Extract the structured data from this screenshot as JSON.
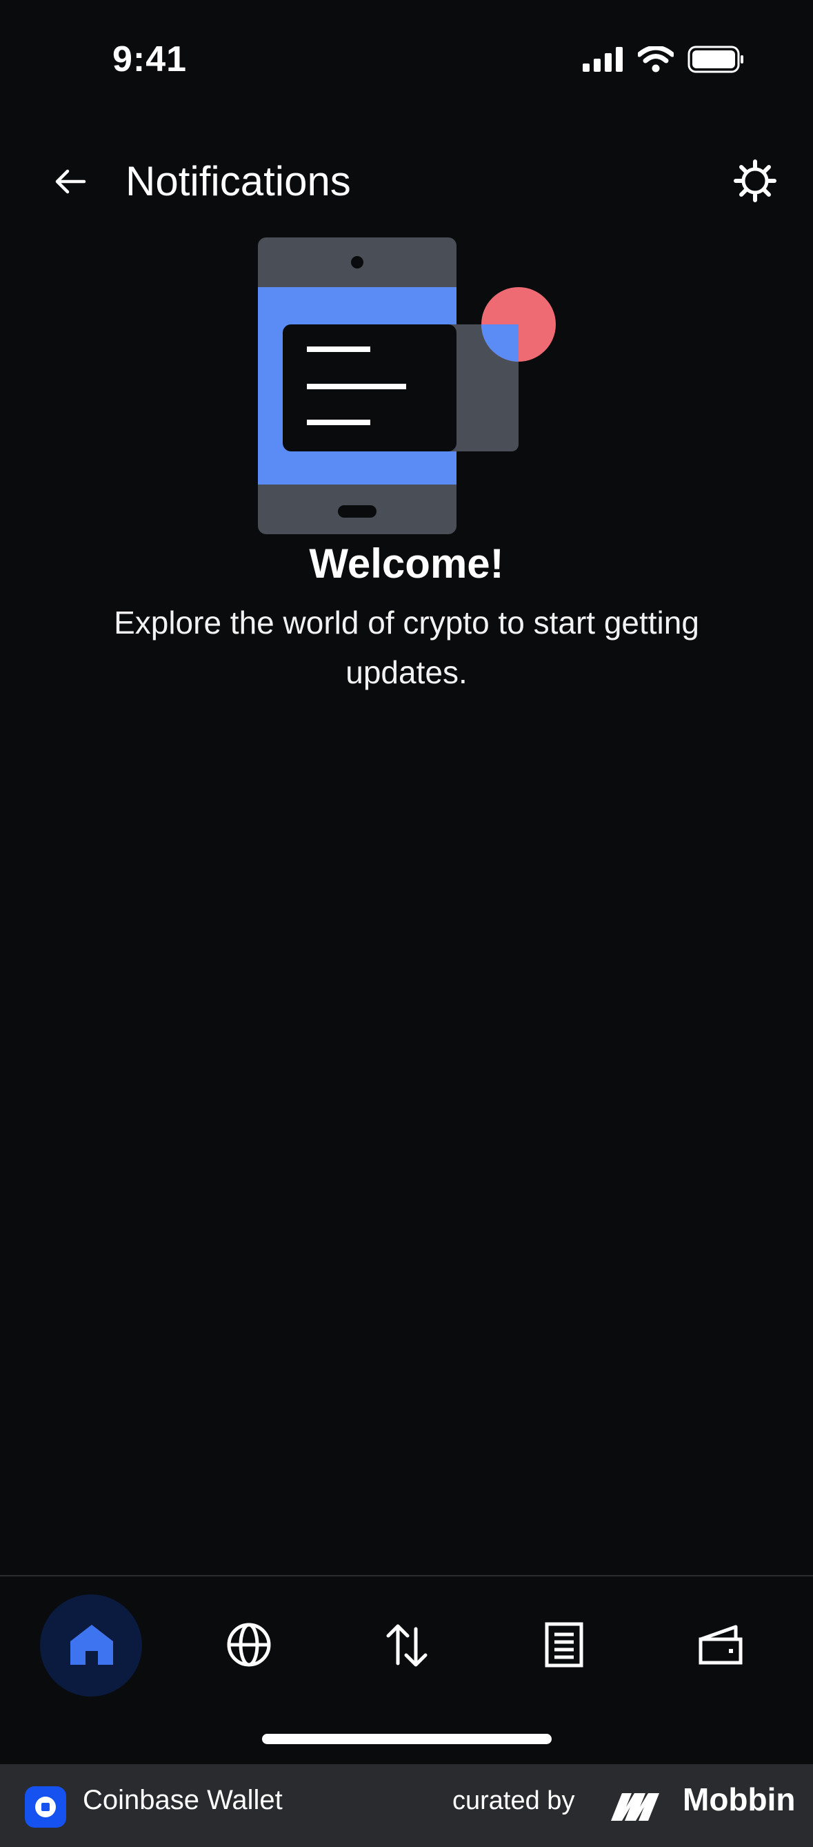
{
  "status_bar": {
    "time": "9:41"
  },
  "header": {
    "title": "Notifications"
  },
  "empty_state": {
    "title": "Welcome!",
    "message": "Explore the world of crypto to start getting updates."
  },
  "tab_bar": {
    "tabs": [
      {
        "icon": "home-icon",
        "active": true
      },
      {
        "icon": "globe-icon",
        "active": false
      },
      {
        "icon": "swap-arrows-icon",
        "active": false
      },
      {
        "icon": "document-icon",
        "active": false
      },
      {
        "icon": "wallet-icon",
        "active": false
      }
    ]
  },
  "footer": {
    "app_name": "Coinbase Wallet",
    "curated_by": "curated by",
    "brand": "Mobbin"
  },
  "colors": {
    "background": "#0a0b0d",
    "accent_blue": "#5b8cf5",
    "illustration_gray": "#4a4e57",
    "illustration_red": "#ef6b74",
    "active_tab_bg": "#0b1b3f",
    "footer_bg": "#2a2b2e"
  }
}
